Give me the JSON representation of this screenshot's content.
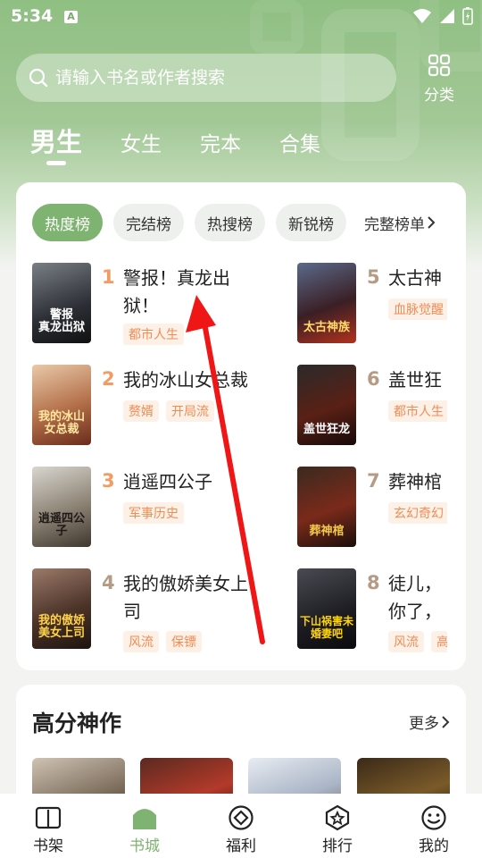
{
  "status": {
    "time": "5:34",
    "badge": "A"
  },
  "search": {
    "placeholder": "请输入书名或作者搜索"
  },
  "category": {
    "label": "分类"
  },
  "tabs": [
    {
      "label": "男生",
      "active": true
    },
    {
      "label": "女生"
    },
    {
      "label": "完本"
    },
    {
      "label": "合集"
    }
  ],
  "rank_chips": [
    {
      "label": "热度榜",
      "active": true
    },
    {
      "label": "完结榜"
    },
    {
      "label": "热搜榜"
    },
    {
      "label": "新锐榜"
    }
  ],
  "rank_more": "完整榜单",
  "books": [
    {
      "rank": "1",
      "title": "警报！真龙出狱！",
      "tags": [
        "都市人生"
      ],
      "cover_text": "警报\n真龙出狱"
    },
    {
      "rank": "2",
      "title": "我的冰山女总裁",
      "tags": [
        "赘婿",
        "开局流"
      ],
      "cover_text": "我的冰山女总裁"
    },
    {
      "rank": "3",
      "title": "逍遥四公子",
      "tags": [
        "军事历史"
      ],
      "cover_text": "逍遥四公子"
    },
    {
      "rank": "4",
      "title": "我的傲娇美女上司",
      "tags": [
        "风流",
        "保镖"
      ],
      "cover_text": "我的傲娇美女上司"
    },
    {
      "rank": "5",
      "title": "太古神",
      "tags": [
        "血脉觉醒"
      ],
      "cover_text": "太古神族"
    },
    {
      "rank": "6",
      "title": "盖世狂",
      "tags": [
        "都市人生"
      ],
      "cover_text": "盖世狂龙"
    },
    {
      "rank": "7",
      "title": "葬神棺",
      "tags": [
        "玄幻奇幻"
      ],
      "cover_text": "葬神棺"
    },
    {
      "rank": "8",
      "title": "徒儿，你了，下",
      "tags": [
        "风流",
        "高"
      ],
      "cover_text": "下山祸害未婚妻吧"
    }
  ],
  "high_score": {
    "title": "高分神作",
    "more": "更多"
  },
  "bottom_nav": [
    {
      "label": "书架",
      "icon": "book-icon"
    },
    {
      "label": "书城",
      "icon": "store-icon",
      "active": true
    },
    {
      "label": "福利",
      "icon": "diamond-icon"
    },
    {
      "label": "排行",
      "icon": "star-badge-icon"
    },
    {
      "label": "我的",
      "icon": "smile-icon"
    }
  ],
  "colors": {
    "accent": "#7fb371",
    "tag_text": "#ef8d55",
    "header_bg": "#8fbf82",
    "annotation_arrow": "#f01616"
  }
}
